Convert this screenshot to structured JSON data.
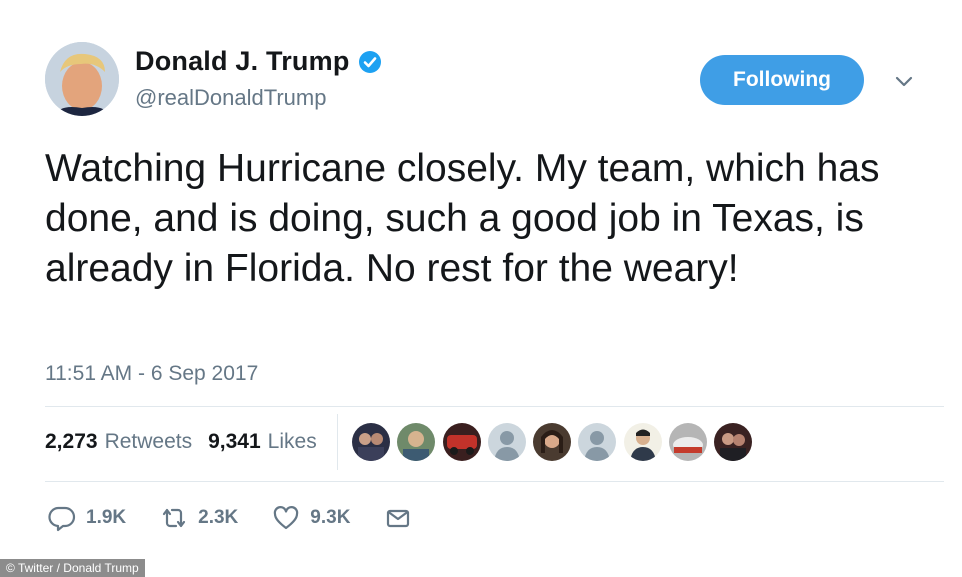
{
  "user": {
    "name": "Donald J. Trump",
    "handle": "@realDonaldTrump",
    "follow_label": "Following"
  },
  "tweet": {
    "text": "Watching Hurricane closely. My team, which has done, and is doing, such a good job in Texas, is already in Florida. No rest for the weary!",
    "timestamp": "11:51 AM - 6 Sep 2017"
  },
  "stats": {
    "retweets_count": "2,273",
    "retweets_label": "Retweets",
    "likes_count": "9,341",
    "likes_label": "Likes"
  },
  "likers": [
    "liker-photo",
    "liker-photo",
    "liker-photo",
    "default-avatar",
    "liker-photo",
    "default-avatar",
    "liker-photo",
    "liker-photo",
    "liker-photo"
  ],
  "actions": {
    "reply_count": "1.9K",
    "retweet_count": "2.3K",
    "like_count": "9.3K"
  },
  "credit": "© Twitter / Donald Trump",
  "colors": {
    "accent": "#3f9ee6",
    "secondary_text": "#657786",
    "verified": "#1da1f2"
  }
}
